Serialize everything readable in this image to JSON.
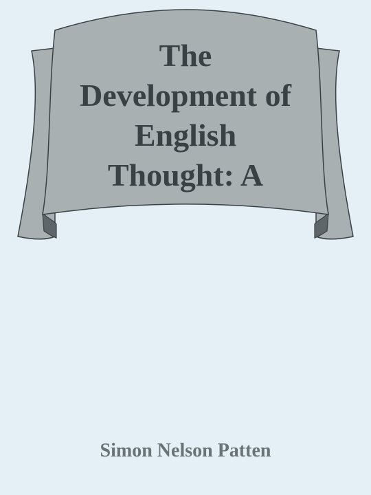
{
  "cover": {
    "title_lines": [
      "The",
      "Development of",
      "English",
      "Thought: A"
    ],
    "author": "Simon Nelson Patten"
  },
  "colors": {
    "background": "#e4f0f5",
    "banner_fill": "#a9b0b2",
    "banner_fold": "#5f6669",
    "banner_stroke": "#3a4145",
    "title_text": "#3a4145",
    "author_text": "#6a7376"
  }
}
